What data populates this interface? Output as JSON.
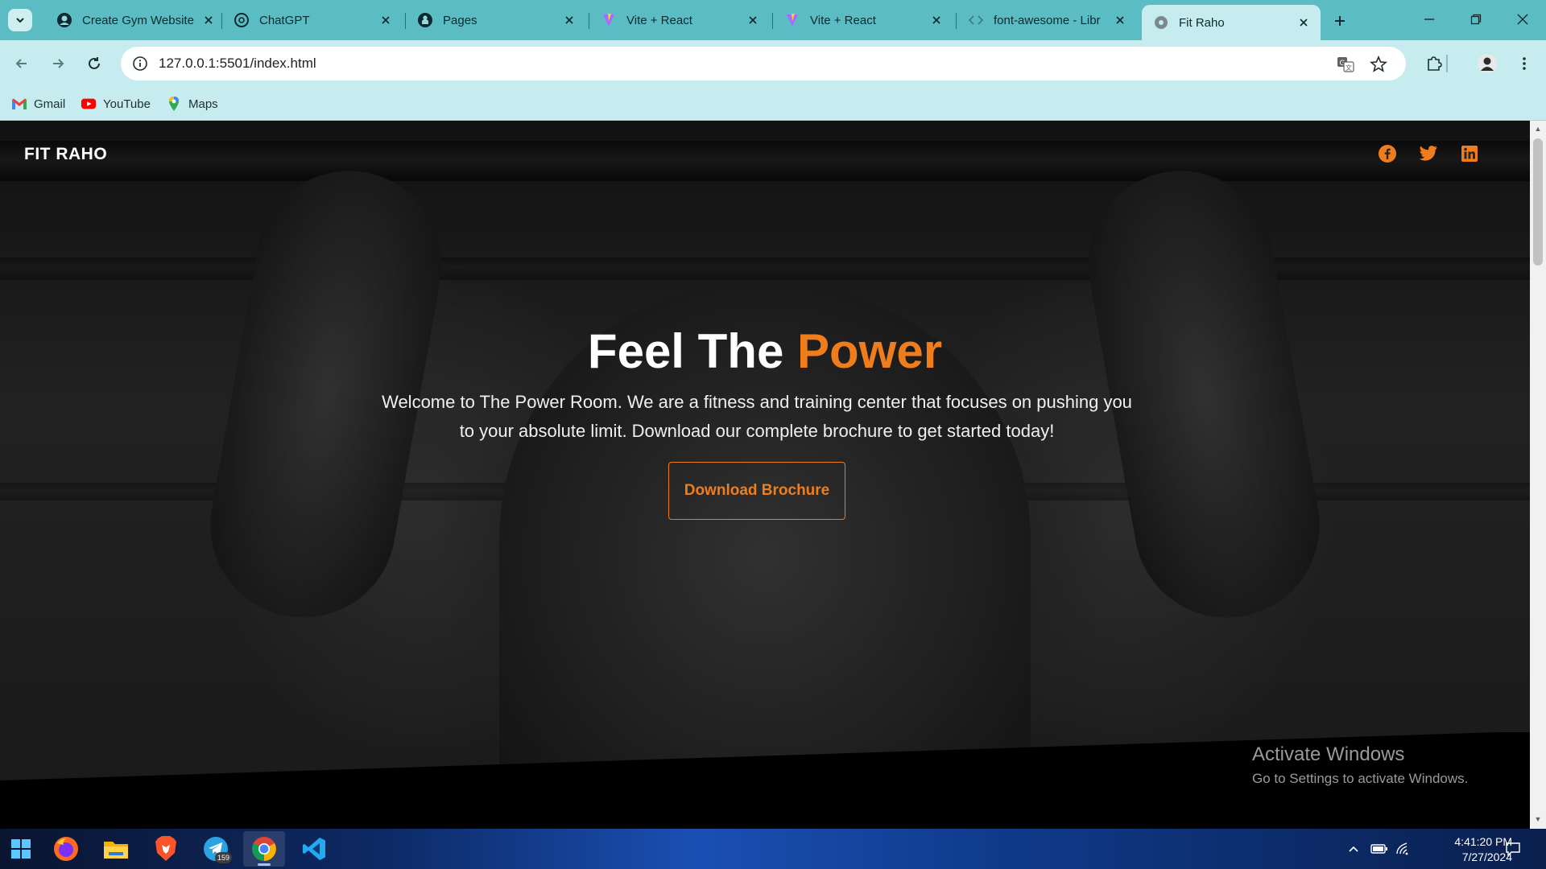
{
  "browser": {
    "tabs": [
      {
        "title": "Create Gym Website",
        "icon": "globe-user-icon",
        "active": false
      },
      {
        "title": "ChatGPT",
        "icon": "chatgpt-icon",
        "active": false
      },
      {
        "title": "Pages",
        "icon": "github-icon",
        "active": false
      },
      {
        "title": "Vite + React",
        "icon": "vite-icon",
        "active": false
      },
      {
        "title": "Vite + React",
        "icon": "vite-icon",
        "active": false
      },
      {
        "title": "font-awesome - Libr",
        "icon": "code-icon",
        "active": false
      },
      {
        "title": "Fit Raho",
        "icon": "globe-icon",
        "active": true
      }
    ],
    "url": "127.0.0.1:5501/index.html",
    "bookmarks": [
      {
        "label": "Gmail",
        "icon": "gmail-icon"
      },
      {
        "label": "YouTube",
        "icon": "youtube-icon"
      },
      {
        "label": "Maps",
        "icon": "maps-icon"
      }
    ]
  },
  "page": {
    "brand": "FIT RAHO",
    "social": [
      "facebook-icon",
      "twitter-icon",
      "linkedin-icon"
    ],
    "hero": {
      "title_main": "Feel The",
      "title_accent": "Power",
      "text": "Welcome to The Power Room. We are a fitness and training center that focuses on pushing you to your absolute limit. Download our complete brochure to get started today!",
      "cta_label": "Download Brochure"
    },
    "colors": {
      "accent": "#f07d1c",
      "chrome": "#5bbcc4"
    }
  },
  "windows_notice": {
    "line1": "Activate Windows",
    "line2": "Go to Settings to activate Windows."
  },
  "taskbar": {
    "apps": [
      "windows-start-icon",
      "firefox-icon",
      "file-explorer-icon",
      "brave-icon",
      "telegram-icon",
      "chrome-icon",
      "vscode-icon"
    ],
    "telegram_badge": "159",
    "time": "4:41:20 PM",
    "date": "7/27/2024"
  }
}
